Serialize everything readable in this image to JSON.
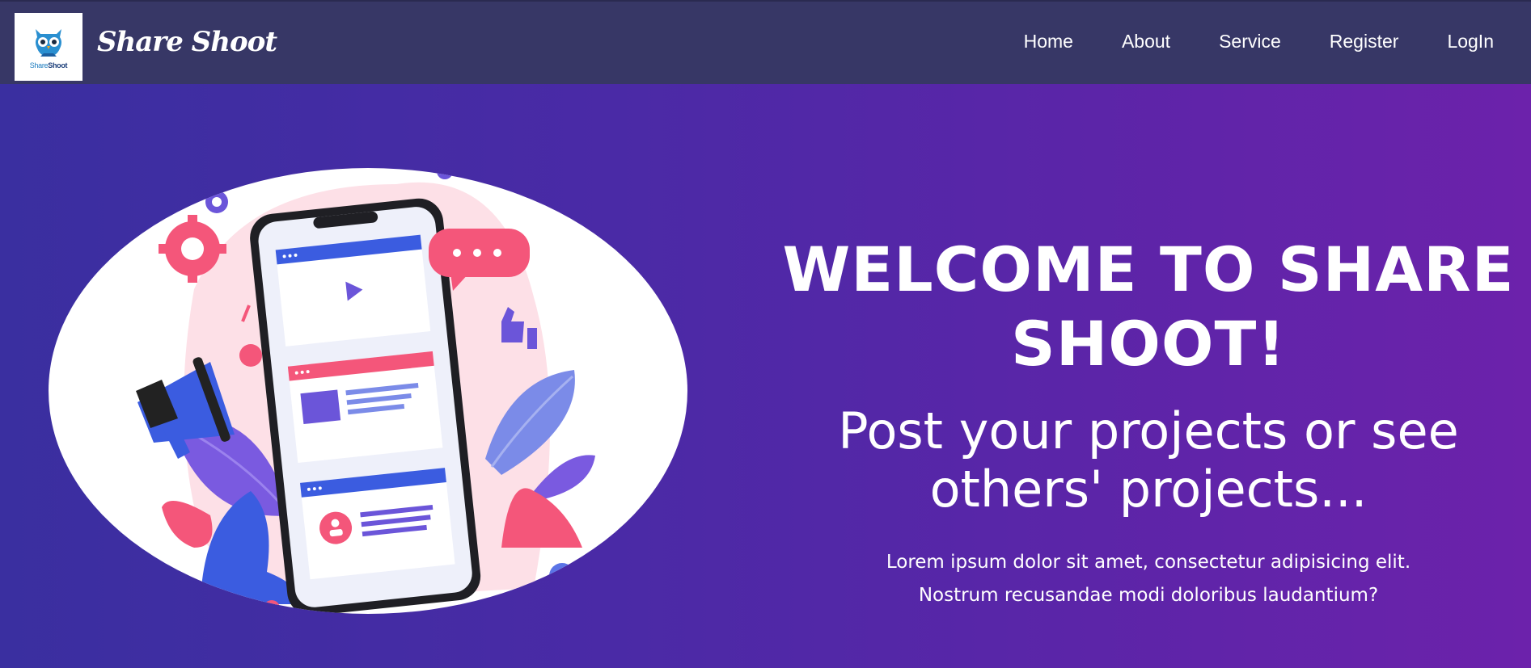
{
  "navbar": {
    "logo_caption_prefix": "Share",
    "logo_caption_suffix": "Shoot",
    "brand": "Share Shoot",
    "links": [
      {
        "label": "Home"
      },
      {
        "label": "About"
      },
      {
        "label": "Service"
      },
      {
        "label": "Register"
      },
      {
        "label": "LogIn"
      }
    ]
  },
  "hero": {
    "title_line1": "WELCOME TO SHARE",
    "title_line2": "SHOOT!",
    "subtitle_line1": "Post your projects or see",
    "subtitle_line2": "others' projects...",
    "body_line1": "Lorem ipsum dolor sit amet, consectetur adipisicing elit.",
    "body_line2": "Nostrum recusandae modi doloribus laudantium?"
  },
  "colors": {
    "navbar_bg": "#373766",
    "hero_gradient_start": "#3a2fa0",
    "hero_gradient_end": "#6c22ab",
    "accent_pink": "#f4567a",
    "accent_blue": "#3b5ce0",
    "accent_purple": "#6b55d9"
  },
  "icons": [
    "owl-logo-icon",
    "phone-illustration",
    "megaphone-icon",
    "gear-icon",
    "chat-bubble-icon",
    "thumbs-up-icon",
    "play-icon",
    "user-icon"
  ]
}
